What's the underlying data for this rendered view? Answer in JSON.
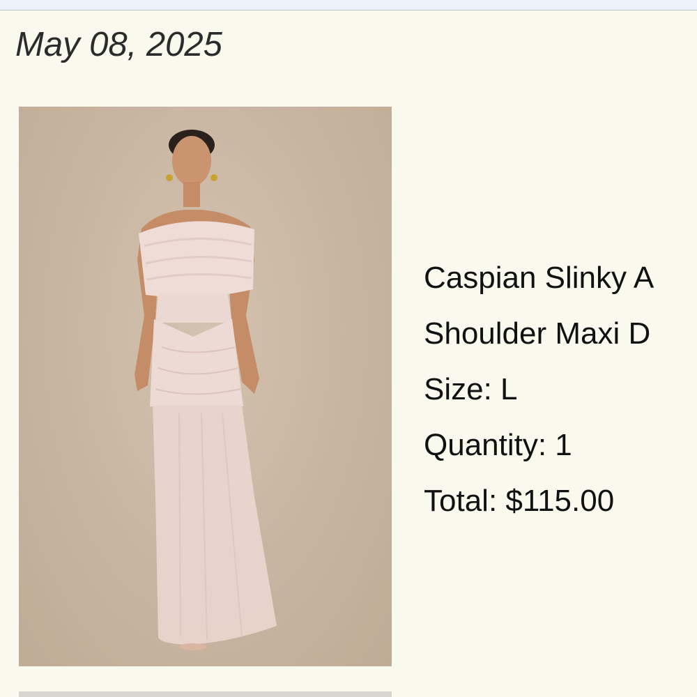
{
  "order": {
    "date": "May 08, 2025"
  },
  "product": {
    "image_icon": "product-photo-dress",
    "name_line1": "Caspian Slinky A",
    "name_line2": "Shoulder Maxi D",
    "size_text": "Size: L",
    "quantity_text": "Quantity: 1",
    "total_text": "Total: $115.00"
  },
  "colors": {
    "page_background": "#faf9ee",
    "image_background": "#c7b39f",
    "dress": "#efdcd6",
    "text": "#111111"
  }
}
